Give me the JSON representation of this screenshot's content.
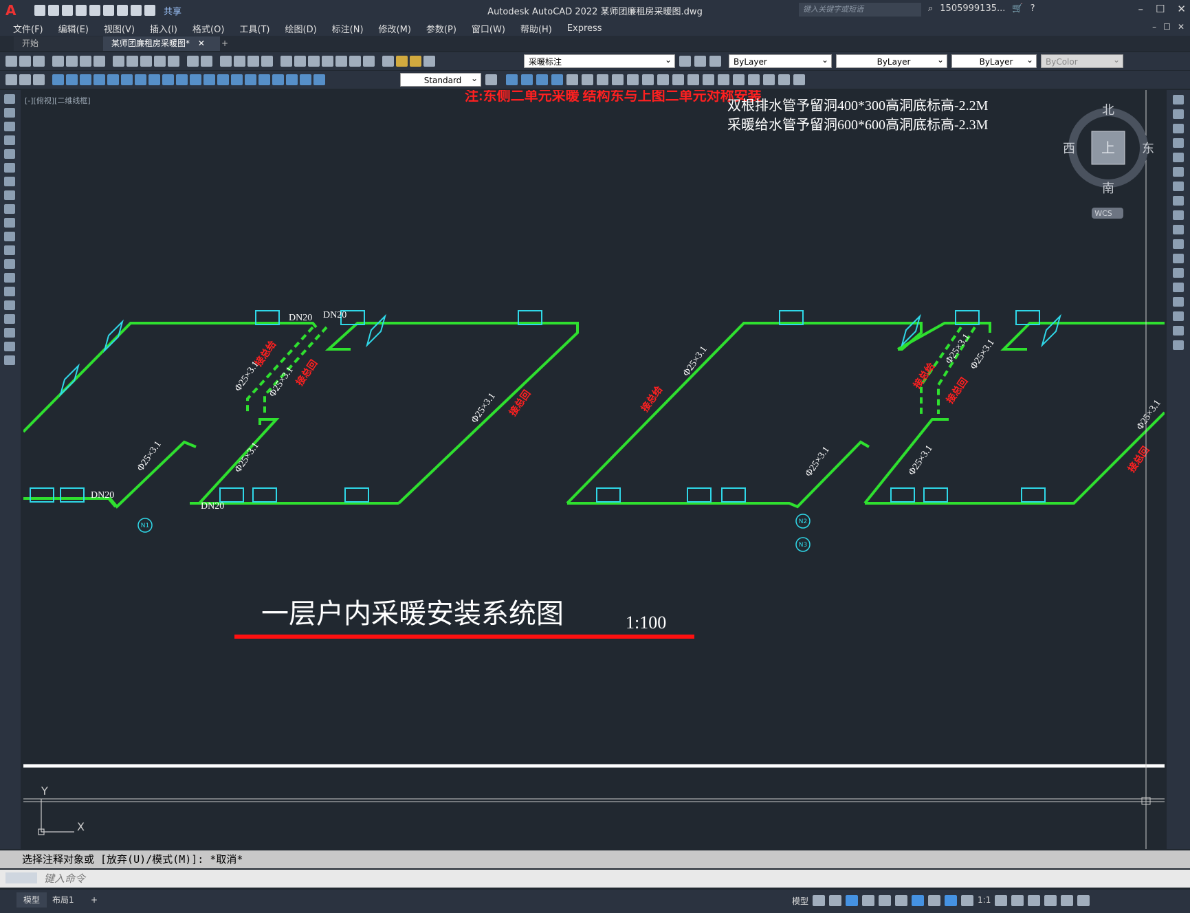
{
  "app": {
    "logo": "A",
    "share": "共享",
    "title": "Autodesk AutoCAD 2022    某师团廉租房采暖图.dwg",
    "search_placeholder": "键入关键字或短语",
    "user": "1505999135...",
    "win_controls": [
      "–",
      "☐",
      "✕"
    ]
  },
  "menu": [
    "文件(F)",
    "编辑(E)",
    "视图(V)",
    "插入(I)",
    "格式(O)",
    "工具(T)",
    "绘图(D)",
    "标注(N)",
    "修改(M)",
    "参数(P)",
    "窗口(W)",
    "帮助(H)",
    "Express"
  ],
  "tabs": {
    "start": "开始",
    "active": "某师团廉租房采暖图*",
    "close": "✕",
    "add": "+"
  },
  "toolbar": {
    "layer": "采暖标注",
    "color": "ByLayer",
    "linetype": "ByLayer",
    "lineweight": "ByLayer",
    "plotstyle": "ByColor",
    "textstyle": "Standard"
  },
  "viewport": {
    "label": "[-][俯视][二维线框]"
  },
  "drawing": {
    "notes_red": "注:东侧二单元采暖 结构东与上图二单元对称安装",
    "notes_white": [
      "双根排水管予留洞400*300高洞底标高-2.2M",
      "采暖给水管予留洞600*600高洞底标高-2.3M"
    ],
    "title": "一层户内采暖安装系统图",
    "scale": "1:100",
    "pipe_labels": [
      "DN20",
      "DN20",
      "DN20",
      "DN20"
    ],
    "size_labels": [
      "Φ25×3.1",
      "Φ25×3.1",
      "Φ25×3.1",
      "Φ25×3.1",
      "Φ25×3.1",
      "Φ25×3.1",
      "Φ25×3.1",
      "Φ25×3.1",
      "Φ25×3.1",
      "Φ25×3.1",
      "Φ25×3.1"
    ],
    "red_labels": [
      "接总给",
      "接总回",
      "接总回",
      "接总给",
      "接总给",
      "接总回",
      "接总回"
    ],
    "markers": [
      "N1",
      "N2",
      "N3"
    ]
  },
  "viewcube": {
    "n": "北",
    "s": "南",
    "w": "西",
    "e": "东",
    "top": "上",
    "wcs": "WCS"
  },
  "ucs": {
    "x": "X",
    "y": "Y"
  },
  "command": {
    "history": "选择注释对象或 [放弃(U)/模式(M)]: *取消*",
    "placeholder": "键入命令"
  },
  "status": {
    "model": "模型",
    "layout": "布局1",
    "add": "+",
    "scale": "1:1"
  },
  "colors": {
    "pipe": "#2fe02f",
    "radiator": "#2fd8e8",
    "red": "#ff2020",
    "bg": "#212830"
  }
}
